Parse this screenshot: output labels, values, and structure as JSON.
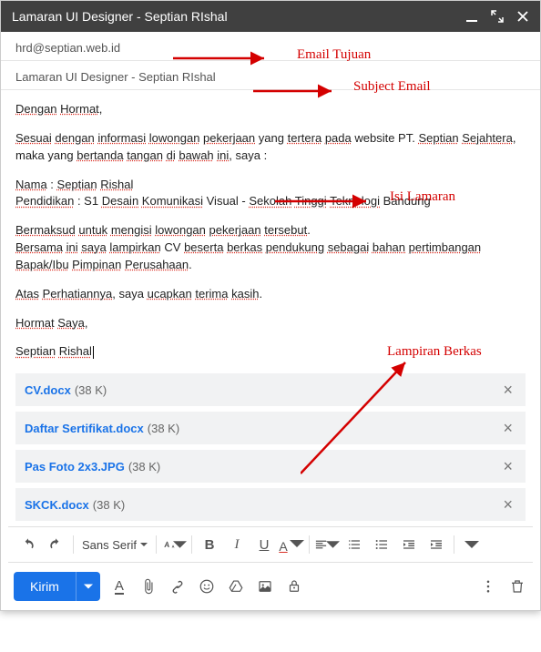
{
  "titlebar": {
    "title": "Lamaran UI Designer - Septian RIshal"
  },
  "to": {
    "value": "hrd@septian.web.id"
  },
  "subject": {
    "value": "Lamaran UI Designer - Septian RIshal"
  },
  "body": {
    "greeting_1": "Dengan",
    "greeting_2": "Hormat",
    "para1_pre": "Sesuai",
    "para1_p1": "dengan",
    "para1_p2": "informasi",
    "para1_p3": "lowongan",
    "para1_p4": "pekerjaan",
    "para1_yang": "yang",
    "para1_p5": "tertera",
    "para1_p6": "pada",
    "para1_web": "website PT.",
    "para1_p7": "Septian",
    "para1_p8": "Sejahtera",
    "para1_maka": "maka",
    "para1_yang2": "yang",
    "para1_p9": "bertanda",
    "para1_p10": "tangan",
    "para1_p11": "di",
    "para1_p12": "bawah",
    "para1_p13": "ini",
    "para1_saya": "saya :",
    "nama_label": "Nama",
    "nama_v1": "Septian",
    "nama_v2": "Rishal",
    "pend_label": "Pendidikan",
    "pend_s1": "S1",
    "pend_p1": "Desain",
    "pend_p2": "Komunikasi",
    "pend_vis": "Visual -",
    "pend_p3": "Sekolah",
    "pend_p4": "Tinggi",
    "pend_p5": "Teknologi",
    "pend_bdg": "Bandung",
    "p3_1": "Bermaksud",
    "p3_2": "untuk",
    "p3_3": "mengisi",
    "p3_4": "lowongan",
    "p3_5": "pekerjaan",
    "p3_6": "tersebut",
    "p4_1": "Bersama",
    "p4_2": "ini",
    "p4_3": "saya",
    "p4_4": "lampirkan",
    "p4_cv": "CV",
    "p4_5": "beserta",
    "p4_6": "berkas",
    "p4_7": "pendukung",
    "p4_8": "sebagai",
    "p4_9": "bahan",
    "p4_10": "pertimbangan",
    "p5_1": "Bapak/Ibu",
    "p5_2": "Pimpinan",
    "p5_3": "Perusahaan",
    "p6_1": "Atas",
    "p6_2": "Perhatiannya",
    "p6_saya": "saya",
    "p6_3": "ucapkan",
    "p6_4": "terima",
    "p6_5": "kasih",
    "close_1": "Hormat",
    "close_2": "Saya",
    "sig_1": "Septian",
    "sig_2": "Rishal"
  },
  "attachments": [
    {
      "name": "CV.docx",
      "size": "(38 K)"
    },
    {
      "name": "Daftar Sertifikat.docx",
      "size": "(38 K)"
    },
    {
      "name": "Pas Foto 2x3.JPG",
      "size": "(38 K)"
    },
    {
      "name": "SKCK.docx",
      "size": "(38 K)"
    }
  ],
  "format": {
    "font": "Sans Serif"
  },
  "send": {
    "label": "Kirim"
  },
  "annotations": {
    "to": "Email Tujuan",
    "subject": "Subject Email",
    "body": "Isi Lamaran",
    "attach": "Lampiran Berkas"
  }
}
